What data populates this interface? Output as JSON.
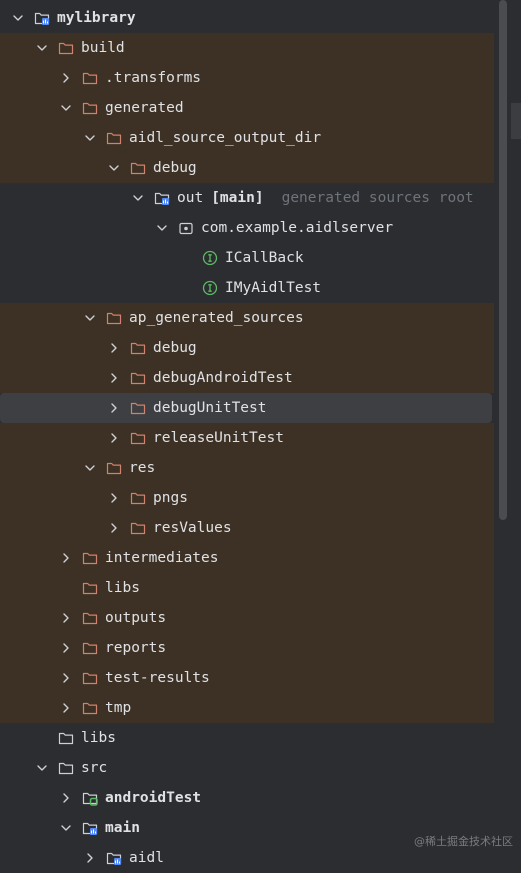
{
  "tree": {
    "items": [
      {
        "label": "mylibrary",
        "depth": 0,
        "chevron": "down",
        "icon": "module-folder-icon",
        "bold": true,
        "bg": "none"
      },
      {
        "label": "build",
        "depth": 1,
        "chevron": "down",
        "icon": "folder-icon",
        "bg": "excluded"
      },
      {
        "label": ".transforms",
        "depth": 2,
        "chevron": "right",
        "icon": "folder-icon",
        "bg": "excluded"
      },
      {
        "label": "generated",
        "depth": 2,
        "chevron": "down",
        "icon": "folder-icon",
        "bg": "excluded"
      },
      {
        "label": "aidl_source_output_dir",
        "depth": 3,
        "chevron": "down",
        "icon": "folder-icon",
        "bg": "excluded"
      },
      {
        "label": "debug",
        "depth": 4,
        "chevron": "down",
        "icon": "folder-icon",
        "bg": "excluded"
      },
      {
        "label": "out",
        "tag": "[main]",
        "hint": "generated sources root",
        "depth": 5,
        "chevron": "down",
        "icon": "generated-source-folder-icon",
        "bg": "gen"
      },
      {
        "label": "com.example.aidlserver",
        "depth": 6,
        "chevron": "down",
        "icon": "package-icon",
        "bg": "gen"
      },
      {
        "label": "ICallBack",
        "depth": 7,
        "chevron": "none",
        "icon": "interface-icon",
        "bg": "gen"
      },
      {
        "label": "IMyAidlTest",
        "depth": 7,
        "chevron": "none",
        "icon": "interface-icon",
        "bg": "gen"
      },
      {
        "label": "ap_generated_sources",
        "depth": 3,
        "chevron": "down",
        "icon": "folder-icon",
        "bg": "excluded"
      },
      {
        "label": "debug",
        "depth": 4,
        "chevron": "right",
        "icon": "folder-icon",
        "bg": "excluded"
      },
      {
        "label": "debugAndroidTest",
        "depth": 4,
        "chevron": "right",
        "icon": "folder-icon",
        "bg": "excluded"
      },
      {
        "label": "debugUnitTest",
        "depth": 4,
        "chevron": "right",
        "icon": "folder-icon",
        "bg": "selected"
      },
      {
        "label": "releaseUnitTest",
        "depth": 4,
        "chevron": "right",
        "icon": "folder-icon",
        "bg": "excluded"
      },
      {
        "label": "res",
        "depth": 3,
        "chevron": "down",
        "icon": "folder-icon",
        "bg": "excluded"
      },
      {
        "label": "pngs",
        "depth": 4,
        "chevron": "right",
        "icon": "folder-icon",
        "bg": "excluded"
      },
      {
        "label": "resValues",
        "depth": 4,
        "chevron": "right",
        "icon": "folder-icon",
        "bg": "excluded"
      },
      {
        "label": "intermediates",
        "depth": 2,
        "chevron": "right",
        "icon": "folder-icon",
        "bg": "excluded"
      },
      {
        "label": "libs",
        "depth": 2,
        "chevron": "none",
        "icon": "folder-icon",
        "bg": "excluded"
      },
      {
        "label": "outputs",
        "depth": 2,
        "chevron": "right",
        "icon": "folder-icon",
        "bg": "excluded"
      },
      {
        "label": "reports",
        "depth": 2,
        "chevron": "right",
        "icon": "folder-icon",
        "bg": "excluded"
      },
      {
        "label": "test-results",
        "depth": 2,
        "chevron": "right",
        "icon": "folder-icon",
        "bg": "excluded"
      },
      {
        "label": "tmp",
        "depth": 2,
        "chevron": "right",
        "icon": "folder-icon",
        "bg": "excluded"
      },
      {
        "label": "libs",
        "depth": 1,
        "chevron": "none",
        "icon": "plain-folder-icon",
        "bg": "none"
      },
      {
        "label": "src",
        "depth": 1,
        "chevron": "down",
        "icon": "plain-folder-icon",
        "bg": "none"
      },
      {
        "label": "androidTest",
        "depth": 2,
        "chevron": "right",
        "icon": "test-source-folder-icon",
        "bold": true,
        "bg": "none"
      },
      {
        "label": "main",
        "depth": 2,
        "chevron": "down",
        "icon": "source-module-folder-icon",
        "bold": true,
        "bg": "none"
      },
      {
        "label": "aidl",
        "depth": 3,
        "chevron": "right",
        "icon": "source-module-folder-icon",
        "bg": "none",
        "partial": true
      }
    ]
  },
  "watermark": "@稀土掘金技术社区",
  "colors": {
    "background": "#2b2d30",
    "excluded": "#3c3124",
    "selected": "#3d3f43",
    "folderExcluded": "#d2826c",
    "folderPlain": "#ced0d6",
    "moduleBlue": "#548af7",
    "testGreen": "#5fb865",
    "interfaceGreen": "#5fb865",
    "hint": "#6f737a"
  }
}
